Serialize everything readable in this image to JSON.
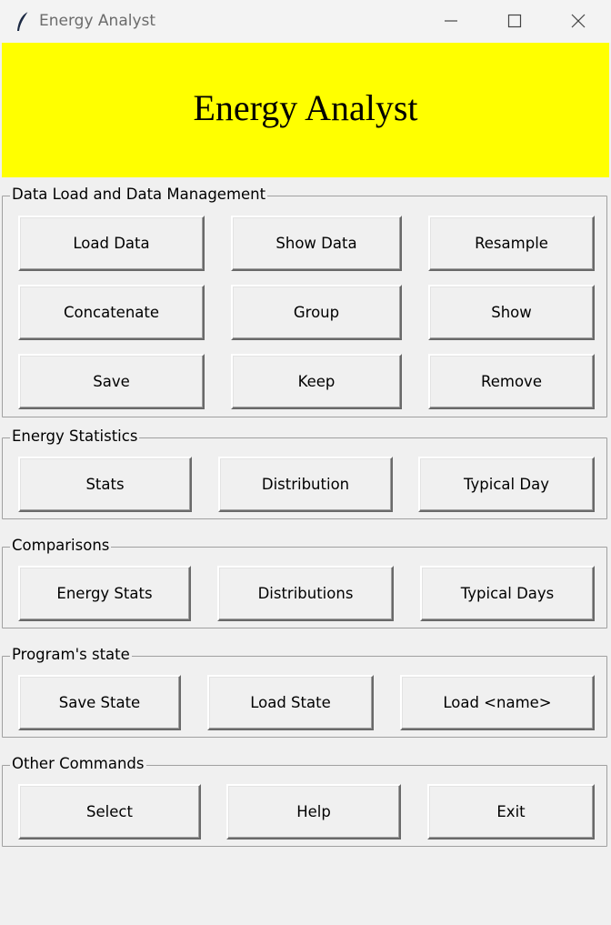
{
  "window": {
    "title": "Energy Analyst",
    "icon": "feather-icon",
    "controls": {
      "minimize": "minimize-icon",
      "maximize": "maximize-icon",
      "close": "close-icon"
    }
  },
  "banner": {
    "title": "Energy Analyst",
    "background": "#ffff00"
  },
  "sections": {
    "data_management": {
      "title": "Data Load and Data Management",
      "buttons": [
        "Load Data",
        "Show Data",
        "Resample",
        "Concatenate",
        "Group",
        "Show",
        "Save",
        "Keep",
        "Remove"
      ]
    },
    "energy_statistics": {
      "title": "Energy Statistics",
      "buttons": [
        "Stats",
        "Distribution",
        "Typical Day"
      ]
    },
    "comparisons": {
      "title": "Comparisons",
      "buttons": [
        "Energy Stats",
        "Distributions",
        "Typical Days"
      ]
    },
    "programs_state": {
      "title": "Program's state",
      "buttons": [
        "Save State",
        "Load State",
        "Load <name>"
      ]
    },
    "other_commands": {
      "title": "Other Commands",
      "buttons": [
        "Select",
        "Help",
        "Exit"
      ]
    }
  }
}
